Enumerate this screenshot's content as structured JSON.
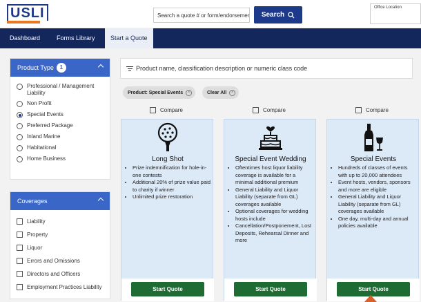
{
  "header": {
    "logo_text": "USLI",
    "search_placeholder": "Search a quote # or form/endorsement",
    "search_label": "Search",
    "office_label": "Office Location"
  },
  "nav": {
    "items": [
      "Dashboard",
      "Forms Library",
      "Start a Quote"
    ],
    "active": "Start a Quote"
  },
  "sidebar": {
    "product_type": {
      "title": "Product Type",
      "badge": "1",
      "options": [
        {
          "label": "Professional / Management Liability",
          "selected": false
        },
        {
          "label": "Non Profit",
          "selected": false
        },
        {
          "label": "Special Events",
          "selected": true
        },
        {
          "label": "Preferred Package",
          "selected": false
        },
        {
          "label": "Inland Marine",
          "selected": false
        },
        {
          "label": "Habitational",
          "selected": false
        },
        {
          "label": "Home Business",
          "selected": false
        }
      ]
    },
    "coverages": {
      "title": "Coverages",
      "options": [
        "Liability",
        "Property",
        "Liquor",
        "Errors and Omissions",
        "Directors and Officers",
        "Employment Practices Liability"
      ]
    }
  },
  "main": {
    "filter_placeholder": "Product name, classification description or numeric class code",
    "chips": {
      "product": "Product: Special Events",
      "clear": "Clear All"
    },
    "compare_label": "Compare",
    "cards": [
      {
        "title": "Long Shot",
        "icon": "golf-ball-icon",
        "bullets": [
          "Prize indemnification for hole-in-one contests",
          "Additional 20% of prize value paid to charity if winner",
          "Unlimited prize restoration"
        ],
        "button": "Start Quote"
      },
      {
        "title": "Special Event Wedding",
        "icon": "wedding-cake-icon",
        "bullets": [
          "Oftentimes host liquor liability coverage is available for a minimal additional premium",
          "General Liability and Liquor Liability (separate from GL) coverages available",
          "Optional coverages for wedding hosts include",
          "Cancellation/Postponement, Lost Deposits, Rehearsal Dinner and more"
        ],
        "button": "Start Quote"
      },
      {
        "title": "Special Events",
        "icon": "wine-bottle-glass-icon",
        "bullets": [
          "Hundreds of classes of events with up to 20,000 attendees",
          "Event hosts, vendors, sponsors and more are eligible",
          "General Liability and Liquor Liability (separate from GL) coverages available",
          "One day, multi-day and annual policies available"
        ],
        "button": "Start Quote"
      }
    ]
  },
  "colors": {
    "brand_blue": "#1d3a8a",
    "nav_bg": "#14275c",
    "panel_head": "#3a67c7",
    "start_btn": "#1f6b34",
    "card_bg": "#dce9f7"
  }
}
